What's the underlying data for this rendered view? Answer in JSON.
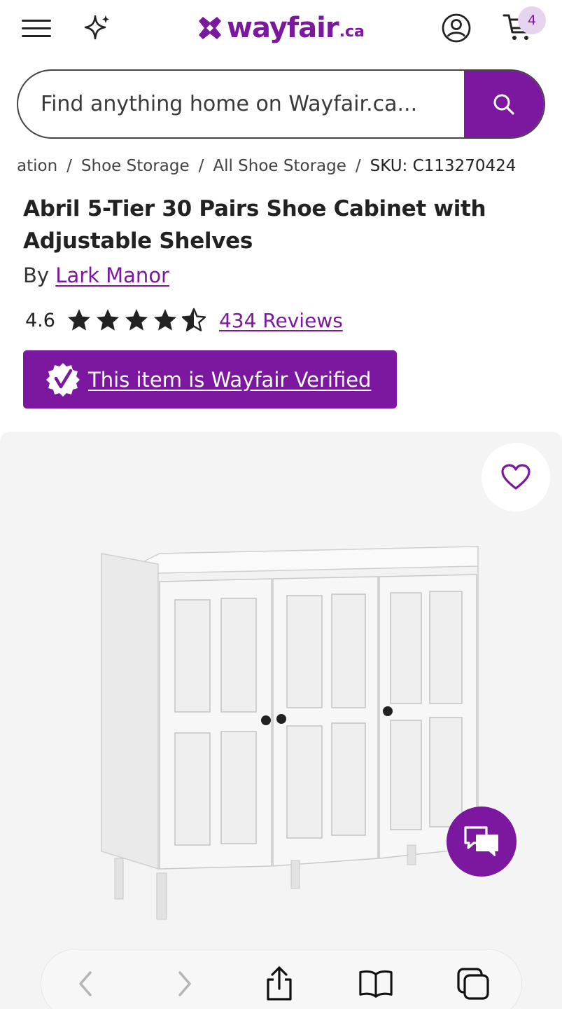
{
  "header": {
    "logo_text": "wayfair",
    "logo_tld": ".ca",
    "cart_count": "4",
    "icons": [
      "menu-icon",
      "sparkle-icon",
      "account-icon",
      "cart-icon"
    ],
    "brand_color": "#7B189F"
  },
  "search": {
    "placeholder": "Find anything home on Wayfair.ca..."
  },
  "breadcrumb": {
    "items": [
      "ation",
      "Shoe Storage",
      "All Shoe Storage"
    ],
    "separator": "/",
    "sku": "SKU: C113270424"
  },
  "product": {
    "title": "Abril 5-Tier 30 Pairs Shoe Cabinet with Adjustable Shelves",
    "by_label": "By",
    "brand": "Lark Manor",
    "rating": "4.6",
    "rating_value": 4.6,
    "rating_max": 5,
    "reviews": "434 Reviews",
    "verified_text": "This item is Wayfair Verified"
  }
}
